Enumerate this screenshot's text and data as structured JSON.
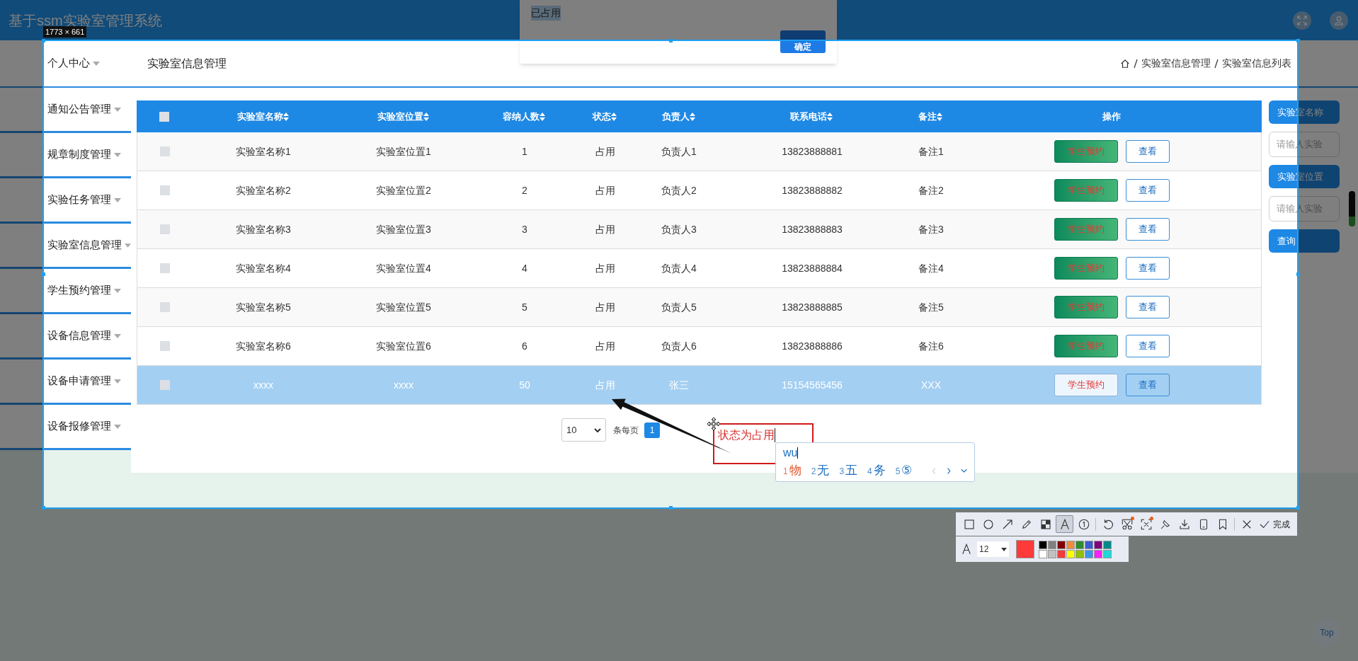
{
  "header": {
    "title": "基于ssm实验室管理系统"
  },
  "dialog": {
    "message": "已占用",
    "button": "确定"
  },
  "sidebar": {
    "items": [
      {
        "label": "个人中心"
      },
      {
        "label": "通知公告管理"
      },
      {
        "label": "规章制度管理"
      },
      {
        "label": "实验任务管理"
      },
      {
        "label": "实验室信息管理"
      },
      {
        "label": "学生预约管理"
      },
      {
        "label": "设备信息管理"
      },
      {
        "label": "设备申请管理"
      },
      {
        "label": "设备报修管理"
      }
    ]
  },
  "page_title": "实验室信息管理",
  "breadcrumb": [
    "实验室信息管理",
    "实验室信息列表"
  ],
  "table": {
    "header_checked": false,
    "columns": [
      {
        "label": "实验室名称",
        "sortable": true
      },
      {
        "label": "实验室位置",
        "sortable": true
      },
      {
        "label": "容纳人数",
        "sortable": true
      },
      {
        "label": "状态",
        "sortable": true
      },
      {
        "label": "负责人",
        "sortable": true
      },
      {
        "label": "联系电话",
        "sortable": true
      },
      {
        "label": "备注",
        "sortable": true
      },
      {
        "label": "操作",
        "sortable": false
      }
    ],
    "rows": [
      {
        "checked": false,
        "selected": false,
        "cells": [
          "实验室名称1",
          "实验室位置1",
          "1",
          "占用",
          "负责人1",
          "13823888881",
          "备注1"
        ],
        "actions": [
          "学生预约",
          "查看"
        ]
      },
      {
        "checked": false,
        "selected": false,
        "cells": [
          "实验室名称2",
          "实验室位置2",
          "2",
          "占用",
          "负责人2",
          "13823888882",
          "备注2"
        ],
        "actions": [
          "学生预约",
          "查看"
        ]
      },
      {
        "checked": false,
        "selected": false,
        "cells": [
          "实验室名称3",
          "实验室位置3",
          "3",
          "占用",
          "负责人3",
          "13823888883",
          "备注3"
        ],
        "actions": [
          "学生预约",
          "查看"
        ]
      },
      {
        "checked": false,
        "selected": false,
        "cells": [
          "实验室名称4",
          "实验室位置4",
          "4",
          "占用",
          "负责人4",
          "13823888884",
          "备注4"
        ],
        "actions": [
          "学生预约",
          "查看"
        ]
      },
      {
        "checked": false,
        "selected": false,
        "cells": [
          "实验室名称5",
          "实验室位置5",
          "5",
          "占用",
          "负责人5",
          "13823888885",
          "备注5"
        ],
        "actions": [
          "学生预约",
          "查看"
        ]
      },
      {
        "checked": false,
        "selected": false,
        "cells": [
          "实验室名称6",
          "实验室位置6",
          "6",
          "占用",
          "负责人6",
          "13823888886",
          "备注6"
        ],
        "actions": [
          "学生预约",
          "查看"
        ]
      },
      {
        "checked": false,
        "selected": true,
        "cells": [
          "xxxx",
          "xxxx",
          "50",
          "占用",
          "张三",
          "15154565456",
          "XXX"
        ],
        "actions": [
          "学生预约",
          "查看"
        ]
      }
    ]
  },
  "search": {
    "items": [
      {
        "kind": "button",
        "label": "实验室名称"
      },
      {
        "kind": "field",
        "placeholder": "请输入实验"
      },
      {
        "kind": "button",
        "label": "实验室位置"
      },
      {
        "kind": "field",
        "placeholder": "请输入实验"
      },
      {
        "kind": "button",
        "label": "查询"
      }
    ]
  },
  "pagination": {
    "page_size": "10",
    "per_page_label": "条每页",
    "pages": [
      {
        "label": "1",
        "selected": true
      }
    ]
  },
  "capture": {
    "size_label": "1773 × 661",
    "annotation_text": "状态为占用",
    "ime": {
      "input": "wu",
      "candidates": [
        {
          "index": "1",
          "text": "物",
          "selected": true
        },
        {
          "index": "2",
          "text": "无",
          "selected": false
        },
        {
          "index": "3",
          "text": "五",
          "selected": false
        },
        {
          "index": "4",
          "text": "务",
          "selected": false
        },
        {
          "index": "5",
          "text": "⑤",
          "selected": false
        }
      ]
    },
    "toolbar": {
      "tools": [
        {
          "kind": "rectangle",
          "selected": false,
          "badge": false
        },
        {
          "kind": "ellipse",
          "selected": false,
          "badge": false
        },
        {
          "kind": "arrow",
          "selected": false,
          "badge": false
        },
        {
          "kind": "pencil",
          "selected": false,
          "badge": false
        },
        {
          "kind": "mosaic",
          "selected": false,
          "badge": false
        },
        {
          "kind": "text",
          "selected": true,
          "badge": false
        },
        {
          "kind": "number",
          "selected": false,
          "badge": false
        },
        {
          "kind": "separator",
          "selected": false,
          "badge": false
        },
        {
          "kind": "undo",
          "selected": false,
          "badge": false
        },
        {
          "kind": "scissors",
          "selected": false,
          "badge": true
        },
        {
          "kind": "crop",
          "selected": false,
          "badge": true
        },
        {
          "kind": "pin",
          "selected": false,
          "badge": false
        },
        {
          "kind": "download",
          "selected": false,
          "badge": false
        },
        {
          "kind": "phone",
          "selected": false,
          "badge": false
        },
        {
          "kind": "bookmark",
          "selected": false,
          "badge": false
        },
        {
          "kind": "separator",
          "selected": false,
          "badge": false
        },
        {
          "kind": "close",
          "selected": false,
          "badge": false
        }
      ],
      "done_label": "完成"
    },
    "style_bar": {
      "font_size": "12",
      "current": {
        "color": "#ff3a3a"
      },
      "palette": [
        {
          "color": "#000000"
        },
        {
          "color": "#808080"
        },
        {
          "color": "#800000"
        },
        {
          "color": "#f08c3c"
        },
        {
          "color": "#2e8b2e"
        },
        {
          "color": "#3c5ad2"
        },
        {
          "color": "#800080"
        },
        {
          "color": "#008b8b"
        },
        {
          "color": "#ffffff"
        },
        {
          "color": "#c0c0c0"
        },
        {
          "color": "#f03c3c"
        },
        {
          "color": "#ffff00"
        },
        {
          "color": "#90c000"
        },
        {
          "color": "#3c96e6"
        },
        {
          "color": "#ff20ff"
        },
        {
          "color": "#20d8d8"
        }
      ]
    }
  },
  "top_button": "Top"
}
